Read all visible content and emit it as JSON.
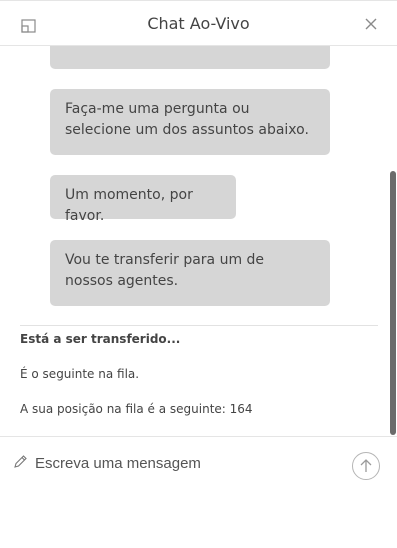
{
  "header": {
    "title": "Chat Ao-Vivo",
    "popout_icon": "popout-window-icon",
    "close_icon": "close-icon"
  },
  "messages": [
    {
      "text": ""
    },
    {
      "text": "Faça-me uma pergunta ou selecione um dos assuntos abaixo."
    },
    {
      "text": "Um momento, por favor."
    },
    {
      "text": "Vou te transferir para um de nossos agentes."
    }
  ],
  "status": {
    "transferring": "Está a ser transferido...",
    "next_in_queue": "É o seguinte na fila.",
    "queue_position": "A sua posição na fila é a seguinte: 164"
  },
  "composer": {
    "placeholder": "Escreva uma mensagem",
    "value": "",
    "pen_icon": "pencil-icon",
    "send_icon": "send-arrow-up-icon"
  },
  "colors": {
    "bubble_bg": "#d6d6d6",
    "scroll_thumb": "#6b6b6b"
  }
}
